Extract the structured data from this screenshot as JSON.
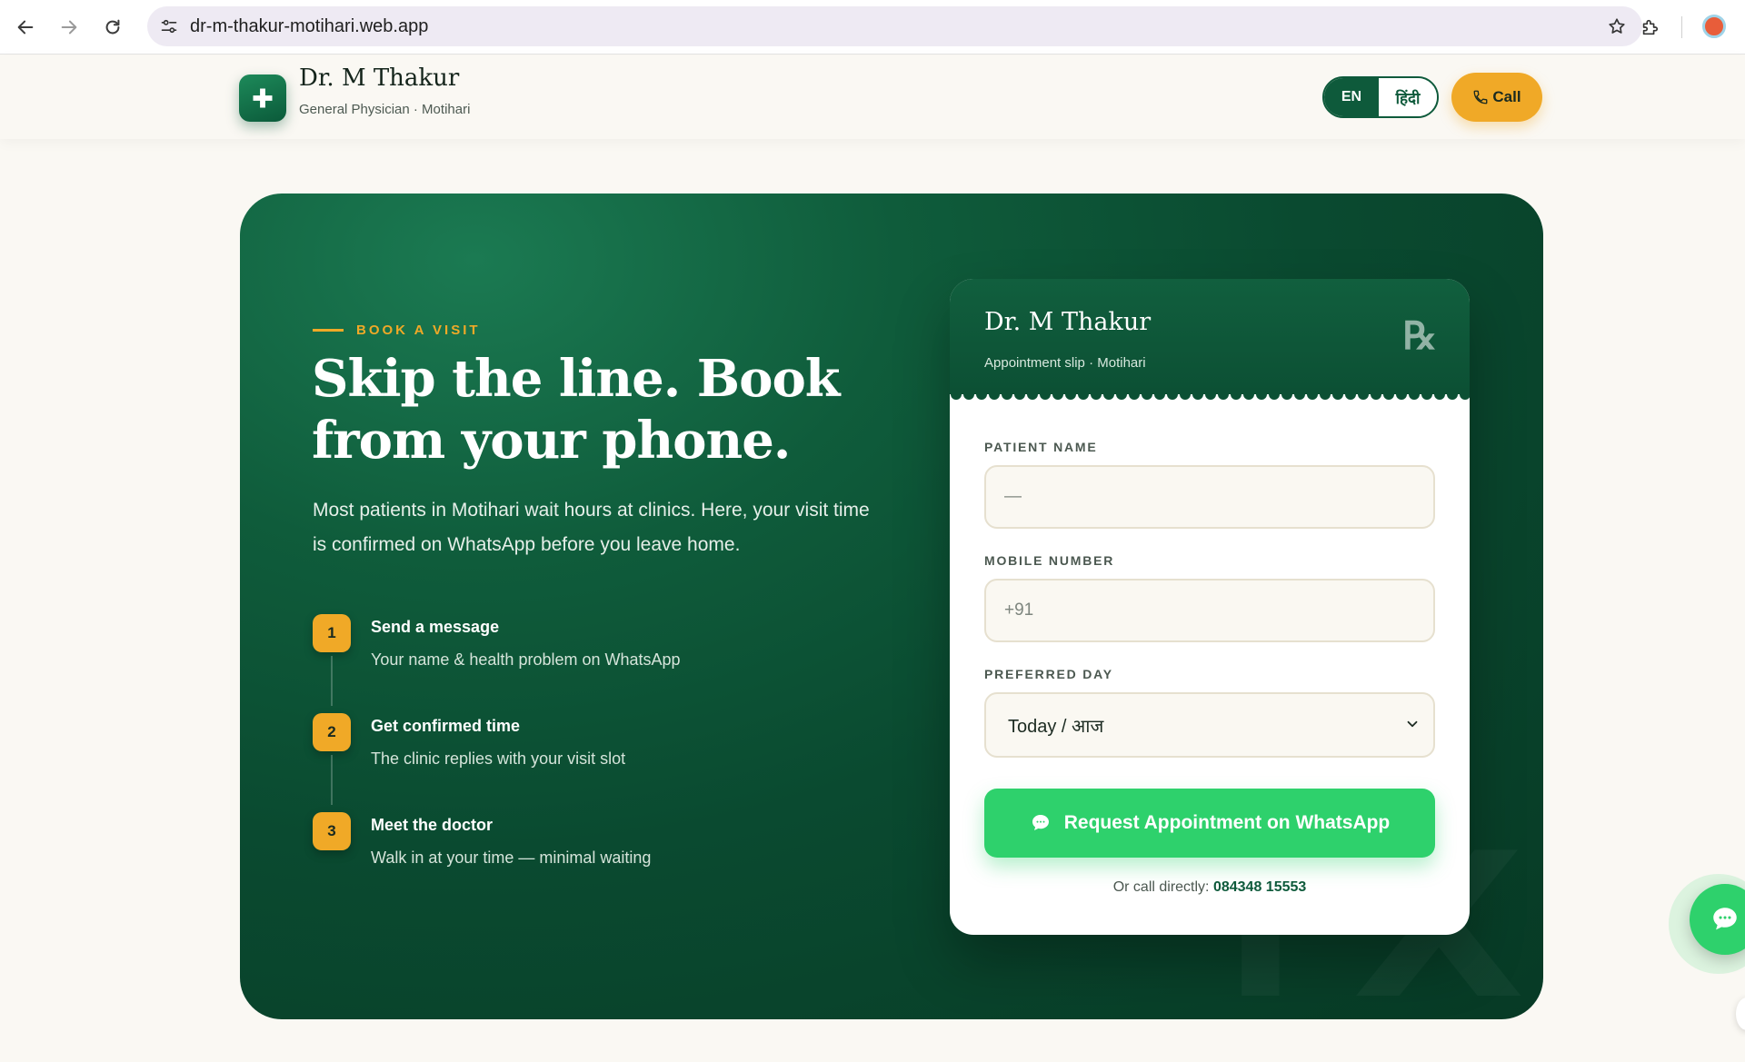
{
  "browser": {
    "url": "dr-m-thakur-motihari.web.app"
  },
  "header": {
    "brand_name": "Dr. M Thakur",
    "brand_sub": "General Physician · Motihari",
    "lang_en": "EN",
    "lang_hi": "हिंदी",
    "call_label": "Call"
  },
  "hero": {
    "eyebrow": "BOOK A VISIT",
    "title": "Skip the line. Book from your phone.",
    "description": "Most patients in Motihari wait hours at clinics. Here, your visit time is confirmed on WhatsApp before you leave home.",
    "steps": [
      {
        "num": "1",
        "title": "Send a message",
        "desc": "Your name & health problem on WhatsApp"
      },
      {
        "num": "2",
        "title": "Get confirmed time",
        "desc": "The clinic replies with your visit slot"
      },
      {
        "num": "3",
        "title": "Meet the doctor",
        "desc": "Walk in at your time — minimal waiting"
      }
    ]
  },
  "slip": {
    "doctor": "Dr. M Thakur",
    "subtitle": "Appointment slip · Motihari",
    "rx": "℞",
    "patient_label": "PATIENT NAME",
    "patient_placeholder": "—",
    "mobile_label": "MOBILE NUMBER",
    "mobile_placeholder": "+91",
    "day_label": "PREFERRED DAY",
    "day_value": "Today / आज",
    "whatsapp_button": "Request Appointment on WhatsApp",
    "call_prefix": "Or call directly:",
    "call_number": "084348 15553"
  },
  "colors": {
    "brand_green": "#0e5a3b",
    "accent_gold": "#f0a927",
    "whatsapp_green": "#2ed16c"
  },
  "icons": {
    "back": "arrow-left-icon",
    "forward": "arrow-right-icon",
    "reload": "reload-icon",
    "site_info": "tune-icon",
    "bookmark": "star-icon",
    "extensions": "puzzle-icon",
    "logo": "medical-cross-icon",
    "phone": "phone-icon",
    "chat": "chat-bubble-icon",
    "chevron": "chevron-down-icon"
  }
}
